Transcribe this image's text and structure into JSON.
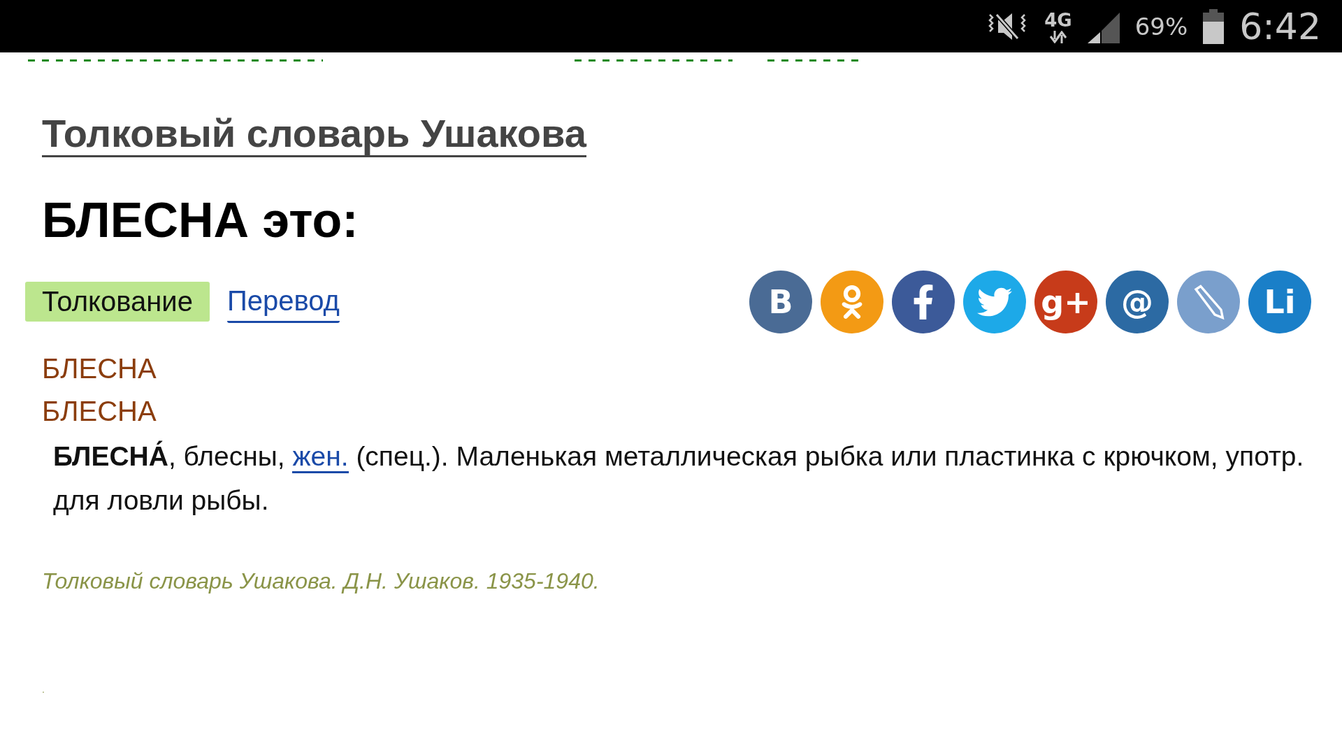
{
  "status_bar": {
    "network": "4G",
    "battery": "69%",
    "time": "6:42"
  },
  "dictionary_link": "Толковый словарь Ушакова",
  "heading": "БЛЕСНА это:",
  "tabs": [
    {
      "label": "Толкование",
      "selected": true
    },
    {
      "label": "Перевод",
      "selected": false
    }
  ],
  "share_buttons": [
    {
      "kind": "letter",
      "label": "B",
      "color": "#4a6b95"
    },
    {
      "kind": "ok",
      "color": "#f39a14"
    },
    {
      "kind": "facebook",
      "color": "#3c5a99"
    },
    {
      "kind": "twitter",
      "color": "#1da9e8"
    },
    {
      "kind": "letter",
      "label": "g+",
      "color": "#c73b1a"
    },
    {
      "kind": "letter",
      "label": "@",
      "color": "#2c6aa3"
    },
    {
      "kind": "pencil",
      "color": "#7a9fcc"
    },
    {
      "kind": "letter",
      "label": "Li",
      "color": "#1a7fc8"
    }
  ],
  "headwords": [
    "БЛЕСНА",
    "БЛЕСНА"
  ],
  "definition": {
    "before": "**БЛЕСНА́**, блесны, ",
    "link": "жен.",
    "after": " (спец.). Маленькая металлическая рыбка или пластинка с крючком, употр. для ловли рыбы."
  },
  "source": "Толковый словарь Ушакова. Д.Н. Ушаков. 1935-1940.",
  "footer_mark": "."
}
